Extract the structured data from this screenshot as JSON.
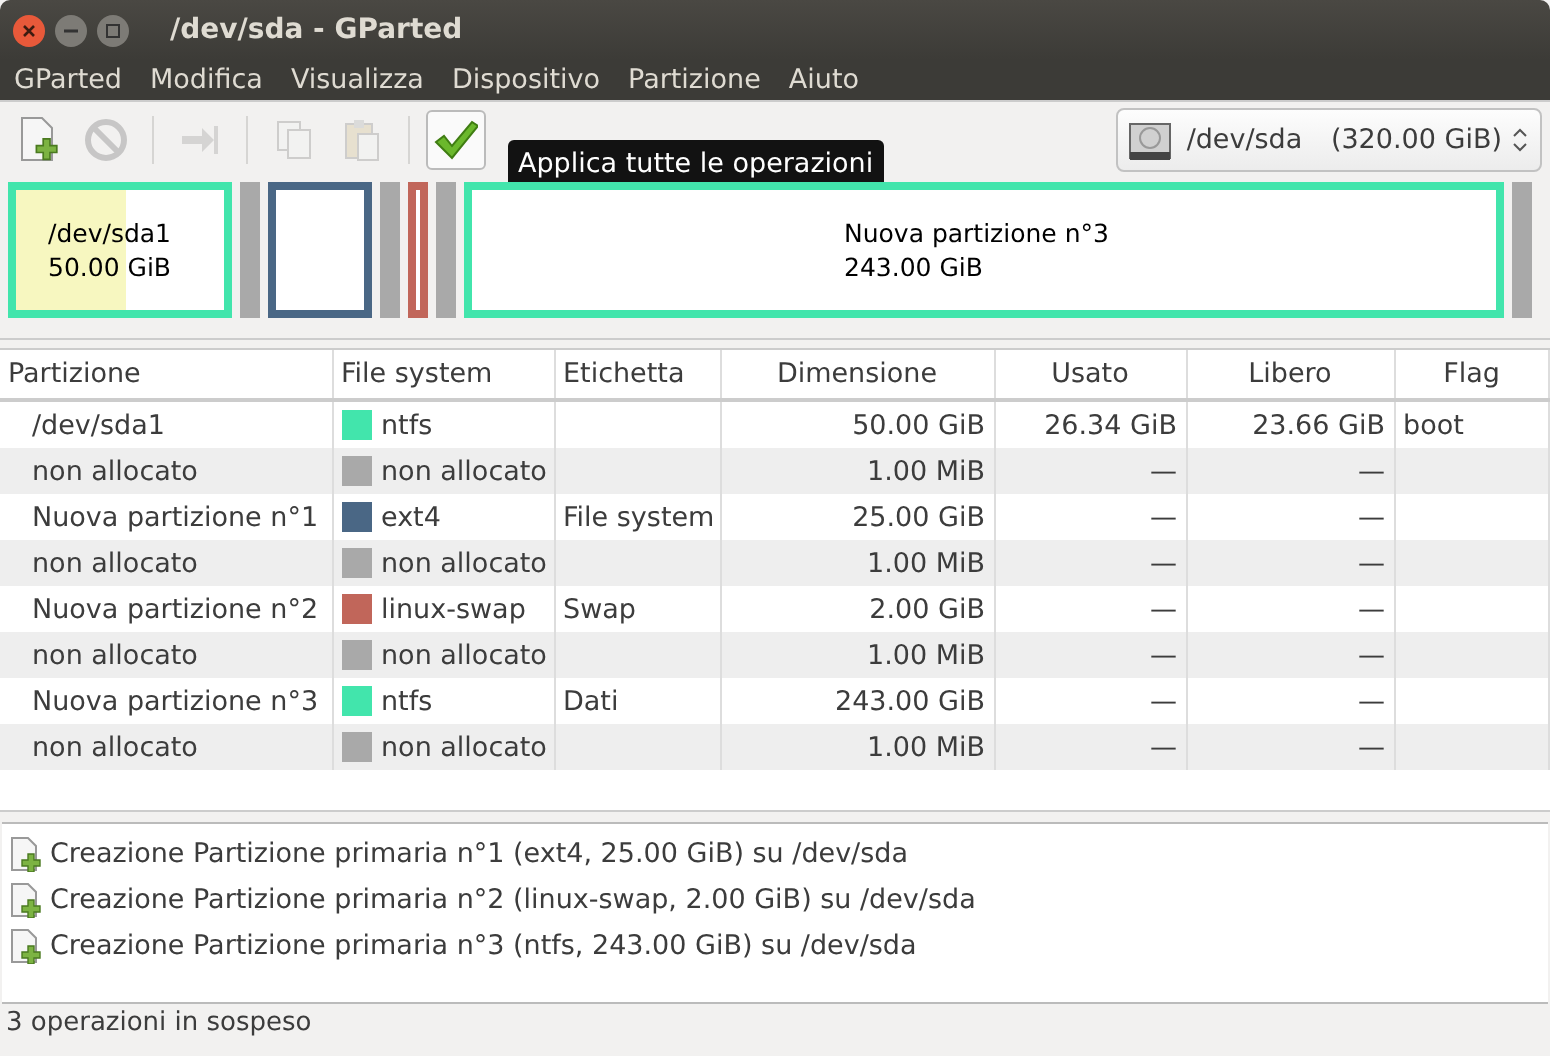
{
  "window": {
    "title": "/dev/sda - GParted"
  },
  "menu": [
    "GParted",
    "Modifica",
    "Visualizza",
    "Dispositivo",
    "Partizione",
    "Aiuto"
  ],
  "toolbar": [
    {
      "kind": "new",
      "disabled": false
    },
    {
      "kind": "cancel",
      "disabled": true
    },
    {
      "kind": "separator"
    },
    {
      "kind": "resize",
      "disabled": true
    },
    {
      "kind": "separator"
    },
    {
      "kind": "copy",
      "disabled": true
    },
    {
      "kind": "paste",
      "disabled": true
    },
    {
      "kind": "separator"
    },
    {
      "kind": "apply",
      "disabled": false
    }
  ],
  "tooltip": "Applica tutte le operazioni",
  "device": {
    "name": "/dev/sda",
    "size": "(320.00 GiB)"
  },
  "partition_map": [
    {
      "kind": "partition",
      "color": "#42e5ac",
      "name": "/dev/sda1",
      "size": "50.00 GiB",
      "level": 0.53
    },
    {
      "kind": "unallocated",
      "color": "#a9a9a9"
    },
    {
      "kind": "partition",
      "color": "#4a6785"
    },
    {
      "kind": "unallocated",
      "color": "#a9a9a9"
    },
    {
      "kind": "partition",
      "color": "#c1665a"
    },
    {
      "kind": "unallocated",
      "color": "#a9a9a9"
    },
    {
      "kind": "partition",
      "color": "#42e5ac",
      "name": "Nuova partizione n°3",
      "size": "243.00 GiB"
    },
    {
      "kind": "unallocated",
      "color": "#a9a9a9"
    }
  ],
  "table": {
    "columns": [
      "Partizione",
      "File system",
      "Etichetta",
      "Dimensione",
      "Usato",
      "Libero",
      "Flag"
    ],
    "rows": [
      {
        "partition": "/dev/sda1",
        "color": "#42e5ac",
        "filesystem": "ntfs",
        "label": "",
        "size": "50.00 GiB",
        "used": "26.34 GiB",
        "free": "23.66 GiB",
        "flag": "boot"
      },
      {
        "partition": "non allocato",
        "color": "#a9a9a9",
        "filesystem": "non allocato",
        "label": "",
        "size": "1.00 MiB",
        "used": "—",
        "free": "—",
        "flag": ""
      },
      {
        "partition": "Nuova partizione n°1",
        "color": "#4a6785",
        "filesystem": "ext4",
        "label": "File system",
        "size": "25.00 GiB",
        "used": "—",
        "free": "—",
        "flag": ""
      },
      {
        "partition": "non allocato",
        "color": "#a9a9a9",
        "filesystem": "non allocato",
        "label": "",
        "size": "1.00 MiB",
        "used": "—",
        "free": "—",
        "flag": ""
      },
      {
        "partition": "Nuova partizione n°2",
        "color": "#c1665a",
        "filesystem": "linux-swap",
        "label": "Swap",
        "size": "2.00 GiB",
        "used": "—",
        "free": "—",
        "flag": ""
      },
      {
        "partition": "non allocato",
        "color": "#a9a9a9",
        "filesystem": "non allocato",
        "label": "",
        "size": "1.00 MiB",
        "used": "—",
        "free": "—",
        "flag": ""
      },
      {
        "partition": "Nuova partizione n°3",
        "color": "#42e5ac",
        "filesystem": "ntfs",
        "label": "Dati",
        "size": "243.00 GiB",
        "used": "—",
        "free": "—",
        "flag": ""
      },
      {
        "partition": "non allocato",
        "color": "#a9a9a9",
        "filesystem": "non allocato",
        "label": "",
        "size": "1.00 MiB",
        "used": "—",
        "free": "—",
        "flag": ""
      }
    ]
  },
  "operations": [
    "Creazione Partizione primaria n°1 (ext4, 25.00 GiB) su /dev/sda",
    "Creazione Partizione primaria n°2 (linux-swap, 2.00 GiB) su /dev/sda",
    "Creazione Partizione primaria n°3 (ntfs, 243.00 GiB) su /dev/sda"
  ],
  "status_bar": "3 operazioni in sospeso"
}
